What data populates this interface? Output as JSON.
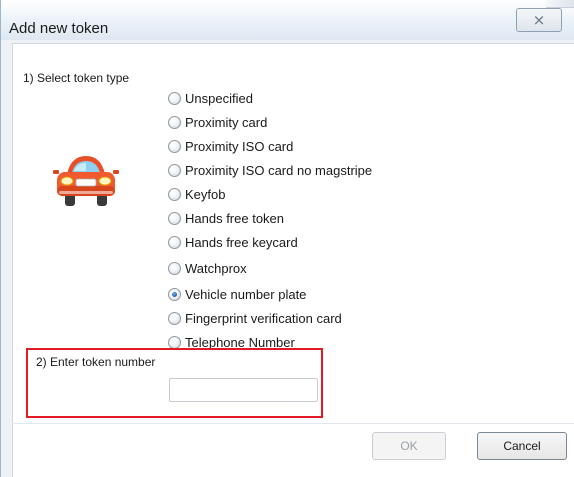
{
  "window": {
    "title": "Add new token",
    "close_glyph": "⨯"
  },
  "section1": {
    "label": "1) Select token type",
    "icon": "car-icon",
    "options": [
      {
        "label": "Unspecified",
        "checked": false
      },
      {
        "label": "Proximity card",
        "checked": false
      },
      {
        "label": "Proximity ISO card",
        "checked": false
      },
      {
        "label": "Proximity ISO card no magstripe",
        "checked": false
      },
      {
        "label": "Keyfob",
        "checked": false
      },
      {
        "label": "Hands free token",
        "checked": false
      },
      {
        "label": "Hands free keycard",
        "checked": false
      },
      {
        "label": "Watchprox",
        "checked": false
      },
      {
        "label": "Vehicle number plate",
        "checked": true
      },
      {
        "label": "Fingerprint verification card",
        "checked": false
      },
      {
        "label": "Telephone Number",
        "checked": false
      }
    ]
  },
  "section2": {
    "label": "2) Enter token number",
    "value": "",
    "highlight_color": "#e01b24"
  },
  "buttons": {
    "ok_label": "OK",
    "ok_enabled": false,
    "cancel_label": "Cancel"
  }
}
